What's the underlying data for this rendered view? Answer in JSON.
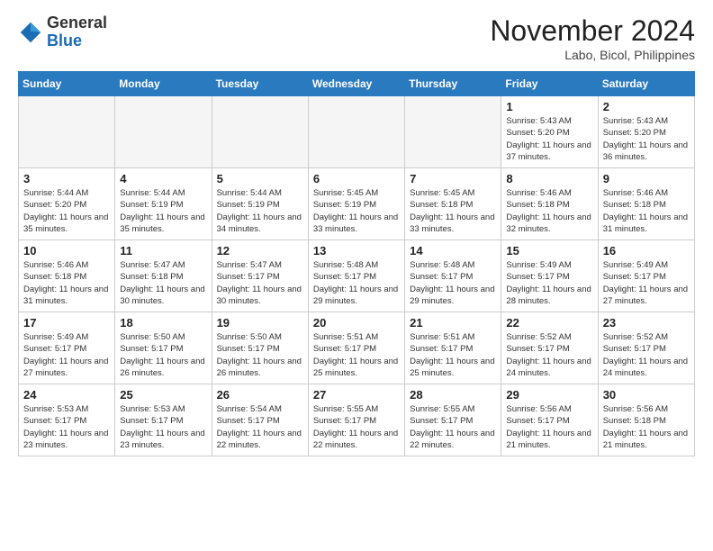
{
  "header": {
    "logo_general": "General",
    "logo_blue": "Blue",
    "month_title": "November 2024",
    "location": "Labo, Bicol, Philippines"
  },
  "weekdays": [
    "Sunday",
    "Monday",
    "Tuesday",
    "Wednesday",
    "Thursday",
    "Friday",
    "Saturday"
  ],
  "weeks": [
    [
      {
        "day": "",
        "info": ""
      },
      {
        "day": "",
        "info": ""
      },
      {
        "day": "",
        "info": ""
      },
      {
        "day": "",
        "info": ""
      },
      {
        "day": "",
        "info": ""
      },
      {
        "day": "1",
        "info": "Sunrise: 5:43 AM\nSunset: 5:20 PM\nDaylight: 11 hours and 37 minutes."
      },
      {
        "day": "2",
        "info": "Sunrise: 5:43 AM\nSunset: 5:20 PM\nDaylight: 11 hours and 36 minutes."
      }
    ],
    [
      {
        "day": "3",
        "info": "Sunrise: 5:44 AM\nSunset: 5:20 PM\nDaylight: 11 hours and 35 minutes."
      },
      {
        "day": "4",
        "info": "Sunrise: 5:44 AM\nSunset: 5:19 PM\nDaylight: 11 hours and 35 minutes."
      },
      {
        "day": "5",
        "info": "Sunrise: 5:44 AM\nSunset: 5:19 PM\nDaylight: 11 hours and 34 minutes."
      },
      {
        "day": "6",
        "info": "Sunrise: 5:45 AM\nSunset: 5:19 PM\nDaylight: 11 hours and 33 minutes."
      },
      {
        "day": "7",
        "info": "Sunrise: 5:45 AM\nSunset: 5:18 PM\nDaylight: 11 hours and 33 minutes."
      },
      {
        "day": "8",
        "info": "Sunrise: 5:46 AM\nSunset: 5:18 PM\nDaylight: 11 hours and 32 minutes."
      },
      {
        "day": "9",
        "info": "Sunrise: 5:46 AM\nSunset: 5:18 PM\nDaylight: 11 hours and 31 minutes."
      }
    ],
    [
      {
        "day": "10",
        "info": "Sunrise: 5:46 AM\nSunset: 5:18 PM\nDaylight: 11 hours and 31 minutes."
      },
      {
        "day": "11",
        "info": "Sunrise: 5:47 AM\nSunset: 5:18 PM\nDaylight: 11 hours and 30 minutes."
      },
      {
        "day": "12",
        "info": "Sunrise: 5:47 AM\nSunset: 5:17 PM\nDaylight: 11 hours and 30 minutes."
      },
      {
        "day": "13",
        "info": "Sunrise: 5:48 AM\nSunset: 5:17 PM\nDaylight: 11 hours and 29 minutes."
      },
      {
        "day": "14",
        "info": "Sunrise: 5:48 AM\nSunset: 5:17 PM\nDaylight: 11 hours and 29 minutes."
      },
      {
        "day": "15",
        "info": "Sunrise: 5:49 AM\nSunset: 5:17 PM\nDaylight: 11 hours and 28 minutes."
      },
      {
        "day": "16",
        "info": "Sunrise: 5:49 AM\nSunset: 5:17 PM\nDaylight: 11 hours and 27 minutes."
      }
    ],
    [
      {
        "day": "17",
        "info": "Sunrise: 5:49 AM\nSunset: 5:17 PM\nDaylight: 11 hours and 27 minutes."
      },
      {
        "day": "18",
        "info": "Sunrise: 5:50 AM\nSunset: 5:17 PM\nDaylight: 11 hours and 26 minutes."
      },
      {
        "day": "19",
        "info": "Sunrise: 5:50 AM\nSunset: 5:17 PM\nDaylight: 11 hours and 26 minutes."
      },
      {
        "day": "20",
        "info": "Sunrise: 5:51 AM\nSunset: 5:17 PM\nDaylight: 11 hours and 25 minutes."
      },
      {
        "day": "21",
        "info": "Sunrise: 5:51 AM\nSunset: 5:17 PM\nDaylight: 11 hours and 25 minutes."
      },
      {
        "day": "22",
        "info": "Sunrise: 5:52 AM\nSunset: 5:17 PM\nDaylight: 11 hours and 24 minutes."
      },
      {
        "day": "23",
        "info": "Sunrise: 5:52 AM\nSunset: 5:17 PM\nDaylight: 11 hours and 24 minutes."
      }
    ],
    [
      {
        "day": "24",
        "info": "Sunrise: 5:53 AM\nSunset: 5:17 PM\nDaylight: 11 hours and 23 minutes."
      },
      {
        "day": "25",
        "info": "Sunrise: 5:53 AM\nSunset: 5:17 PM\nDaylight: 11 hours and 23 minutes."
      },
      {
        "day": "26",
        "info": "Sunrise: 5:54 AM\nSunset: 5:17 PM\nDaylight: 11 hours and 22 minutes."
      },
      {
        "day": "27",
        "info": "Sunrise: 5:55 AM\nSunset: 5:17 PM\nDaylight: 11 hours and 22 minutes."
      },
      {
        "day": "28",
        "info": "Sunrise: 5:55 AM\nSunset: 5:17 PM\nDaylight: 11 hours and 22 minutes."
      },
      {
        "day": "29",
        "info": "Sunrise: 5:56 AM\nSunset: 5:17 PM\nDaylight: 11 hours and 21 minutes."
      },
      {
        "day": "30",
        "info": "Sunrise: 5:56 AM\nSunset: 5:18 PM\nDaylight: 11 hours and 21 minutes."
      }
    ]
  ]
}
